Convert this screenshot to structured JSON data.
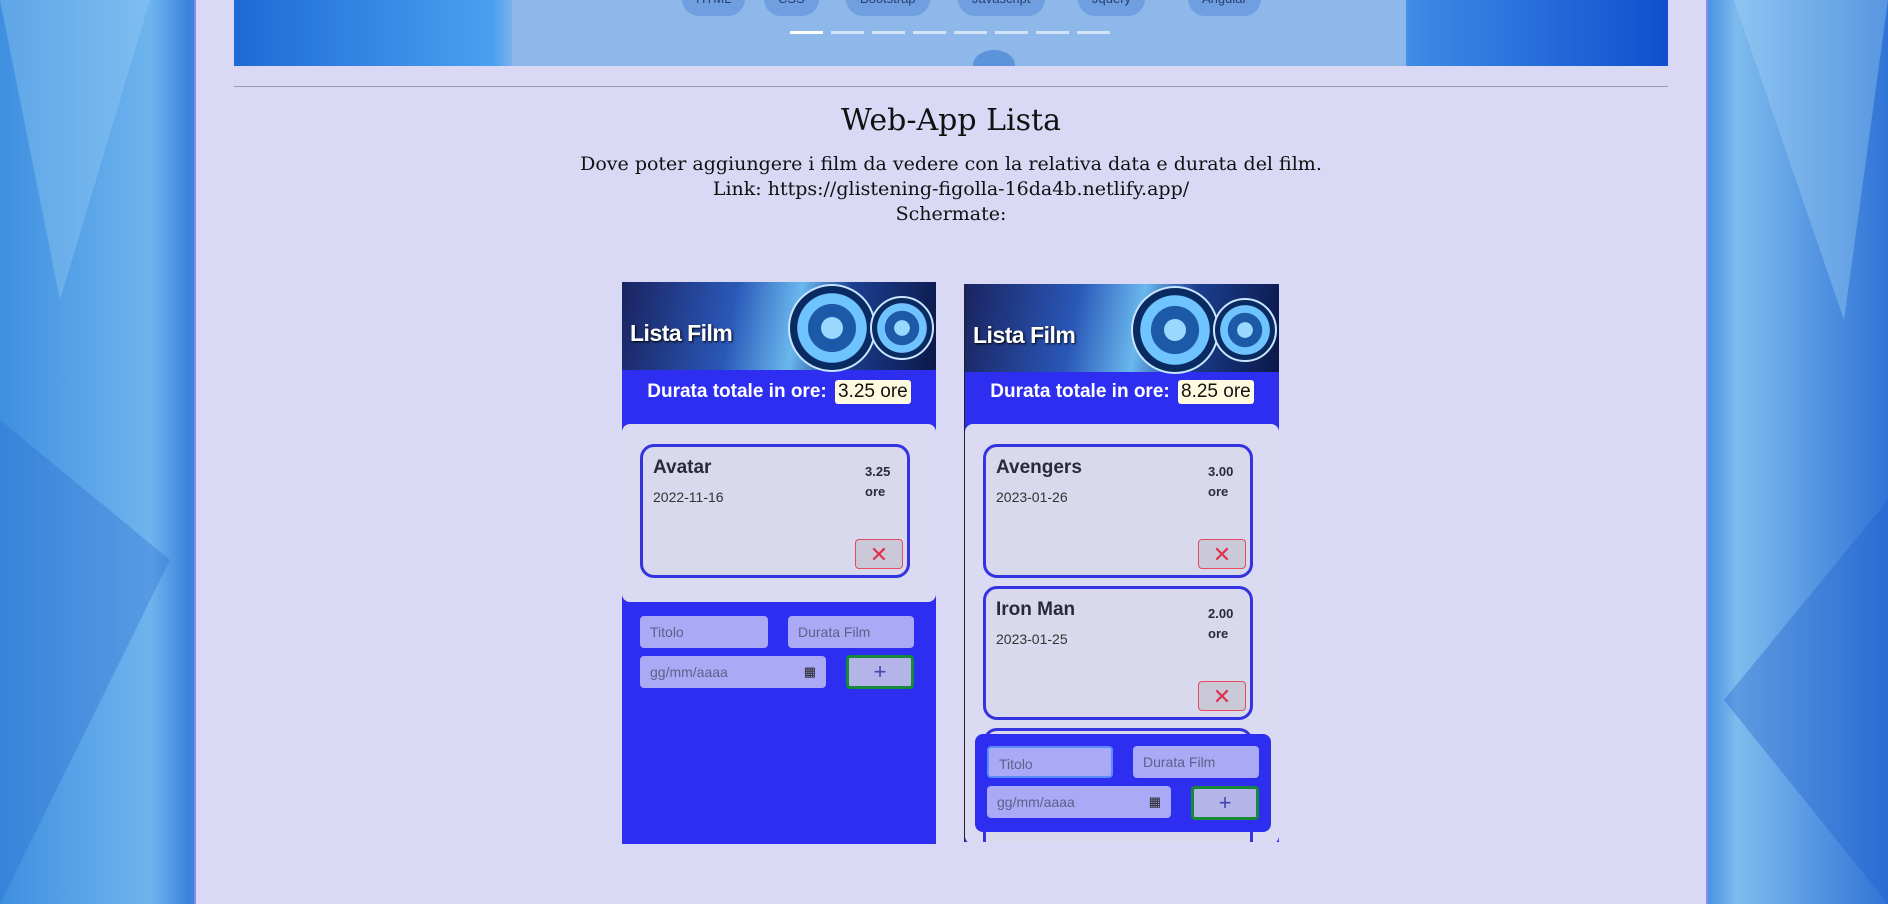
{
  "carousel": {
    "chips": [
      "HTML",
      "CSS",
      "Bootstrap",
      "Javascript",
      "Jquery",
      "Angular"
    ],
    "indicator_count": 8,
    "active_indicator": 1
  },
  "project": {
    "title": "Web-App Lista",
    "description": "Dove poter aggiungere i film da vedere con la relativa data e durata del film.",
    "link_line": "Link: https://glistening-figolla-16da4b.netlify.app/",
    "screens_label": "Schermate:"
  },
  "screens": [
    {
      "banner_title": "Lista Film",
      "total_label": "Durata totale in ore:",
      "total_value": "3.25 ore",
      "films": [
        {
          "name": "Avatar",
          "date": "2022-11-16",
          "duration": "3.25 ore"
        }
      ],
      "form": {
        "title_placeholder": "Titolo",
        "duration_placeholder": "Durata Film",
        "date_placeholder": "gg/mm/aaaa",
        "add_label": "+",
        "delete_label": "✕"
      }
    },
    {
      "banner_title": "Lista Film",
      "total_label": "Durata totale in ore:",
      "total_value": "8.25 ore",
      "films": [
        {
          "name": "Avengers",
          "date": "2023-01-26",
          "duration": "3.00 ore"
        },
        {
          "name": "Iron Man",
          "date": "2023-01-25",
          "duration": "2.00 ore"
        }
      ],
      "form": {
        "title_placeholder": "Titolo",
        "duration_placeholder": "Durata Film",
        "date_placeholder": "gg/mm/aaaa",
        "add_label": "+",
        "delete_label": "✕"
      }
    }
  ]
}
